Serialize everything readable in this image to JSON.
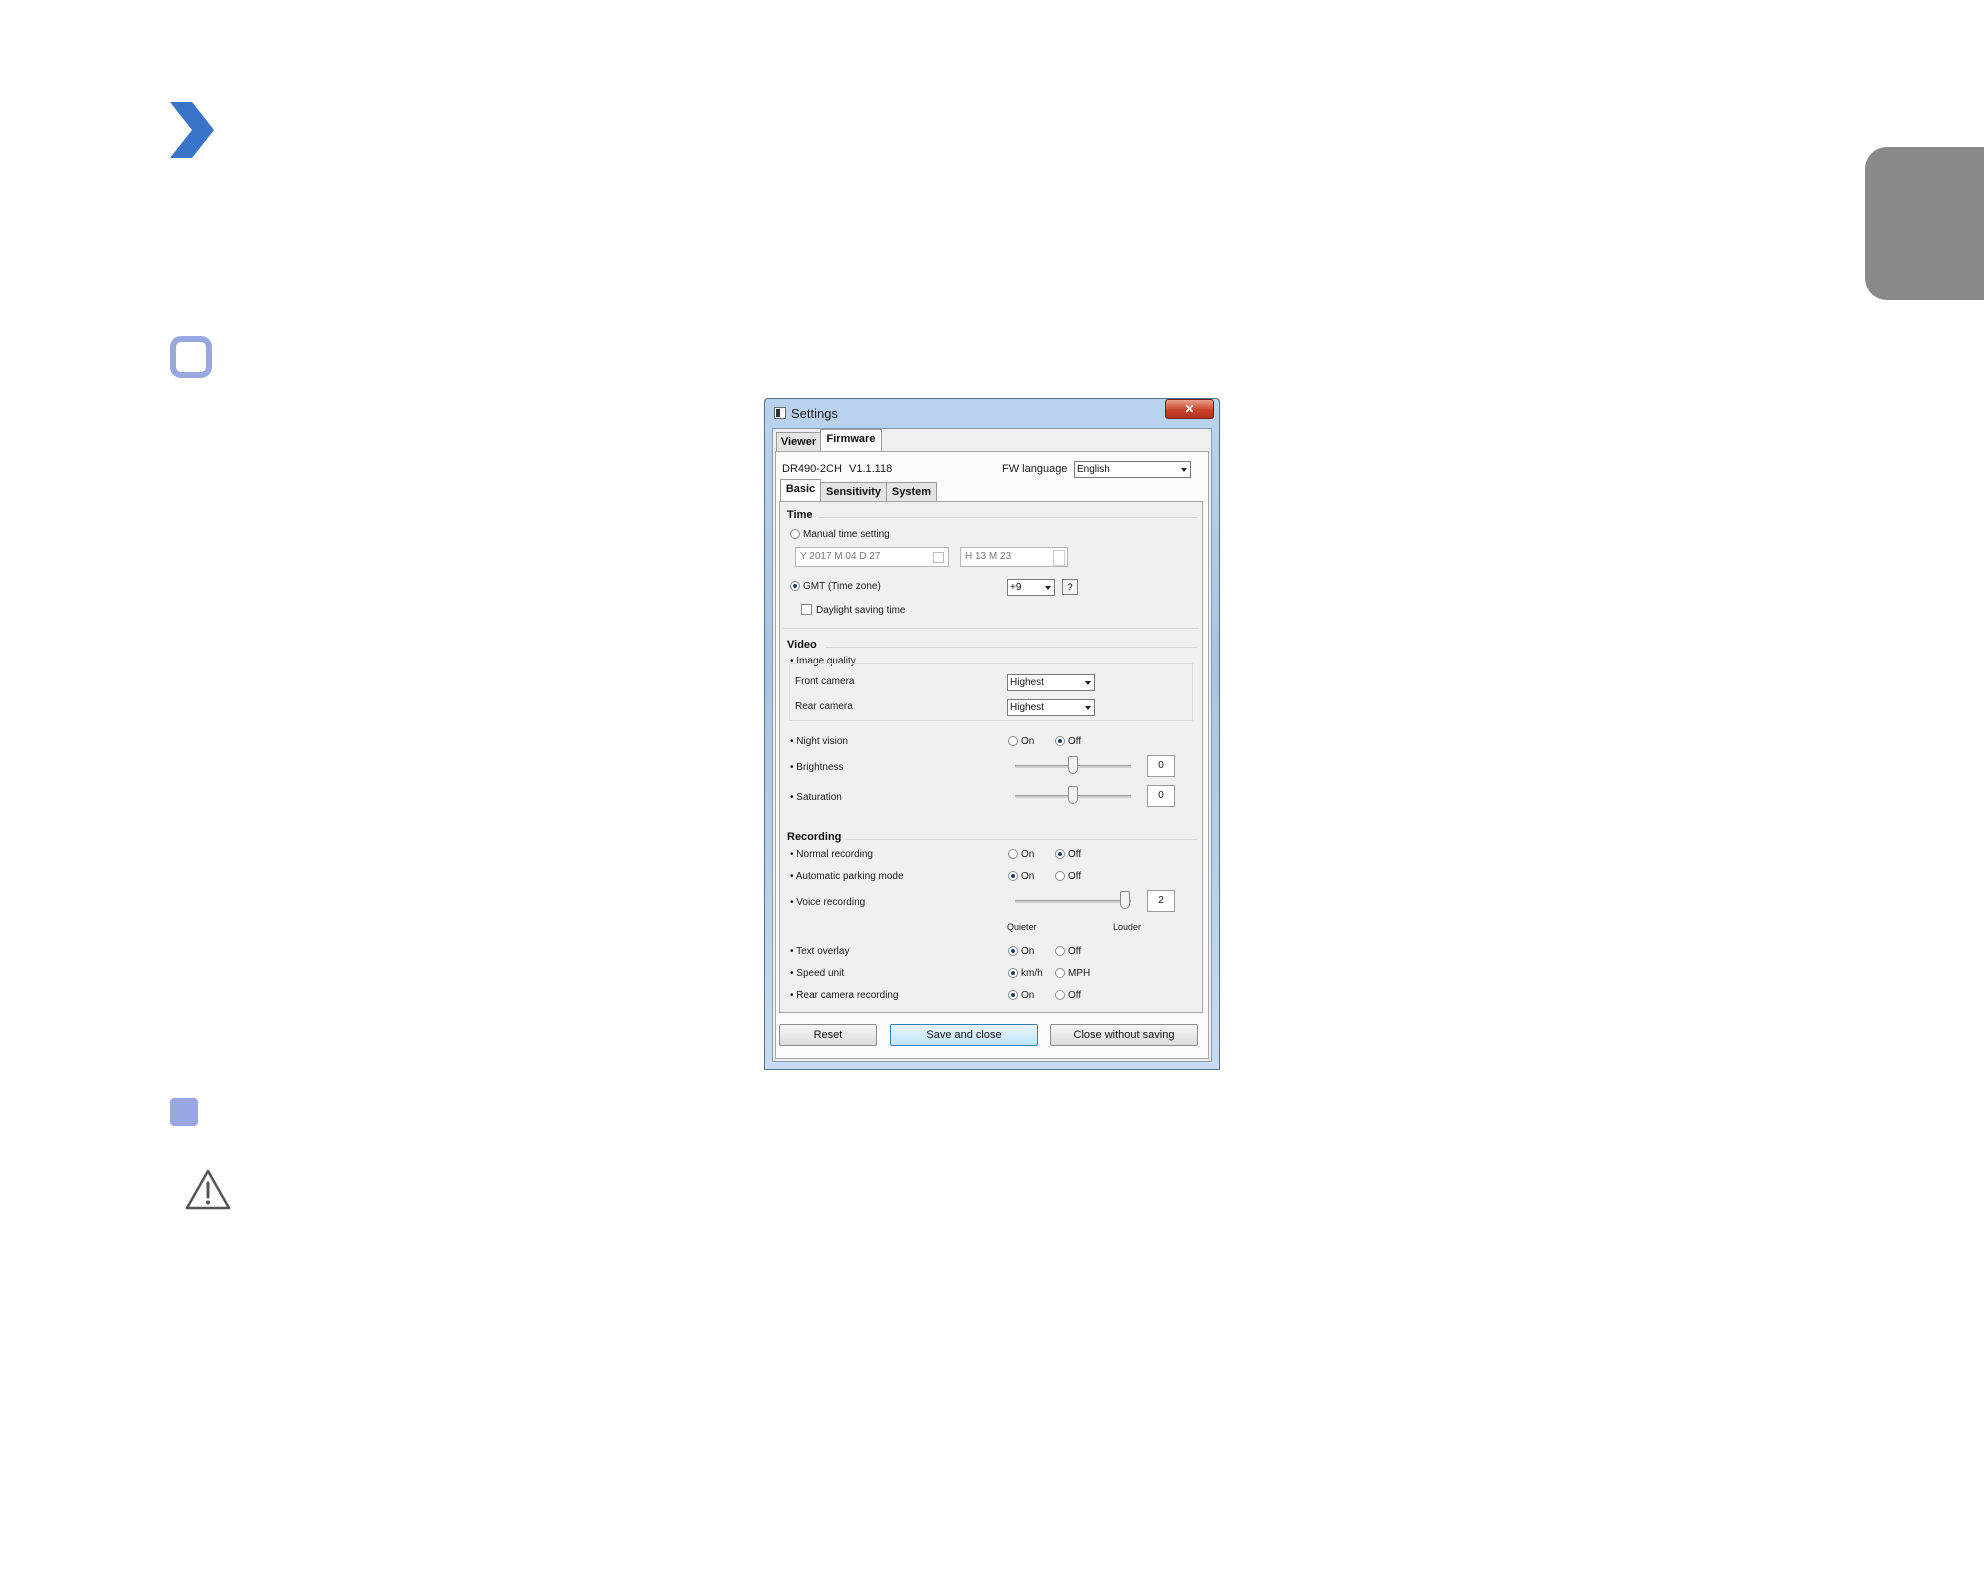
{
  "window": {
    "title": "Settings",
    "close_glyph": "✕",
    "top_tabs": [
      "Viewer",
      "Firmware"
    ],
    "model": "DR490-2CH",
    "version": "V1.1.118",
    "fw_language_label": "FW language",
    "fw_language_value": "English",
    "sub_tabs": [
      "Basic",
      "Sensitivity",
      "System"
    ]
  },
  "time": {
    "section": "Time",
    "manual_label": "Manual time setting",
    "date_value": "Y 2017 M 04 D 27",
    "time_value": "H 13 M 23",
    "gmt_label": "GMT (Time zone)",
    "gmt_value": "+9",
    "help_label": "?",
    "dst_label": "Daylight saving time",
    "mode": "gmt"
  },
  "video": {
    "section": "Video",
    "image_quality_label": "• Image quality",
    "front_label": "Front camera",
    "front_value": "Highest",
    "rear_label": "Rear camera",
    "rear_value": "Highest",
    "night_label": "• Night vision",
    "night_on": "On",
    "night_off": "Off",
    "brightness_label": "• Brightness",
    "brightness_value": "0",
    "saturation_label": "• Saturation",
    "saturation_value": "0"
  },
  "recording": {
    "section": "Recording",
    "normal_label": "• Normal recording",
    "parking_label": "• Automatic parking mode",
    "voice_label": "• Voice recording",
    "voice_value": "2",
    "quieter": "Quieter",
    "louder": "Louder",
    "overlay_label": "• Text overlay",
    "speed_label": "• Speed unit",
    "speed_kmh": "km/h",
    "speed_mph": "MPH",
    "rear_rec_label": "• Rear camera recording",
    "on": "On",
    "off": "Off"
  },
  "buttons": {
    "reset": "Reset",
    "save": "Save and close",
    "close": "Close without saving"
  },
  "colors": {
    "accent_blue": "#3a74c8",
    "accent_light": "#98a7df",
    "side_tab": "#898989"
  }
}
